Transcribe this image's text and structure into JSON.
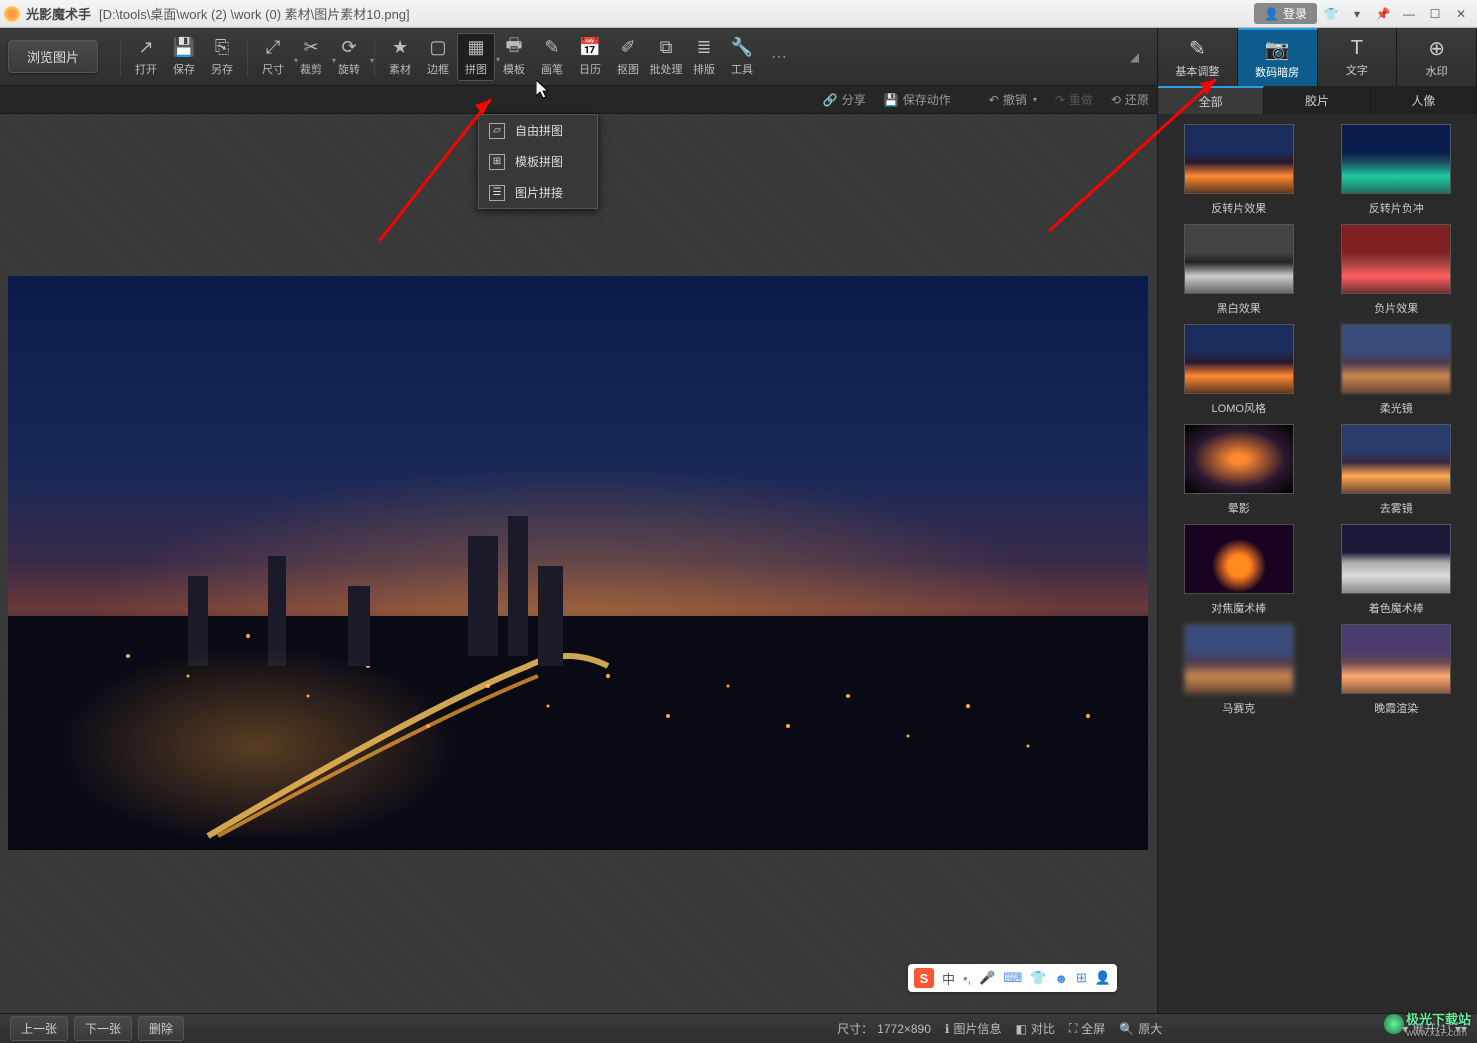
{
  "title_bar": {
    "app_name": "光影魔术手",
    "file_path": "[D:\\tools\\桌面\\work (2) \\work (0) 素材\\图片素材10.png]",
    "login": "登录"
  },
  "toolbar": {
    "browse": "浏览图片",
    "items": [
      {
        "label": "打开",
        "icon": "↗"
      },
      {
        "label": "保存",
        "icon": "💾"
      },
      {
        "label": "另存",
        "icon": "⎘"
      },
      {
        "label": "尺寸",
        "icon": "⤢"
      },
      {
        "label": "裁剪",
        "icon": "✂"
      },
      {
        "label": "旋转",
        "icon": "⟳"
      },
      {
        "label": "素材",
        "icon": "★"
      },
      {
        "label": "边框",
        "icon": "▢"
      },
      {
        "label": "拼图",
        "icon": "▦"
      },
      {
        "label": "模板",
        "icon": "🖶"
      },
      {
        "label": "画笔",
        "icon": "✎"
      },
      {
        "label": "日历",
        "icon": "📅"
      },
      {
        "label": "抠图",
        "icon": "✐"
      },
      {
        "label": "批处理",
        "icon": "⧉"
      },
      {
        "label": "排版",
        "icon": "≣"
      },
      {
        "label": "工具",
        "icon": "🔧"
      }
    ]
  },
  "dropdown": {
    "items": [
      {
        "label": "自由拼图"
      },
      {
        "label": "模板拼图"
      },
      {
        "label": "图片拼接"
      }
    ]
  },
  "right_tabs": [
    {
      "label": "基本调整",
      "icon": "✎"
    },
    {
      "label": "数码暗房",
      "icon": "📷"
    },
    {
      "label": "文字",
      "icon": "T"
    },
    {
      "label": "水印",
      "icon": "⊕"
    }
  ],
  "sec_bar": {
    "share": "分享",
    "save_action": "保存动作",
    "undo": "撤销",
    "redo": "重做",
    "restore": "还原"
  },
  "rp_tabs": [
    "全部",
    "胶片",
    "人像"
  ],
  "effects": [
    {
      "label": "反转片效果",
      "cls": "th-a"
    },
    {
      "label": "反转片负冲",
      "cls": "th-b"
    },
    {
      "label": "黑白效果",
      "cls": "th-bw"
    },
    {
      "label": "负片效果",
      "cls": "th-neg"
    },
    {
      "label": "LOMO风格",
      "cls": "th-a"
    },
    {
      "label": "柔光镜",
      "cls": "th-soft"
    },
    {
      "label": "晕影",
      "cls": "th-vign"
    },
    {
      "label": "去雾镜",
      "cls": "th-dehaze"
    },
    {
      "label": "对焦魔术棒",
      "cls": "th-focus"
    },
    {
      "label": "着色魔术棒",
      "cls": "th-dusk"
    },
    {
      "label": "马赛克",
      "cls": "th-mosaic"
    },
    {
      "label": "晚霞渲染",
      "cls": "th-sun"
    }
  ],
  "bottom": {
    "prev": "上一张",
    "next": "下一张",
    "delete": "删除",
    "size_label": "尺寸：",
    "size_value": "1772×890",
    "info": "图片信息",
    "compare": "对比",
    "fullscreen": "全屏",
    "enlarge": "原大",
    "expand": "展开(1)"
  },
  "ime": {
    "mode": "中"
  },
  "watermark": "极光下载站"
}
